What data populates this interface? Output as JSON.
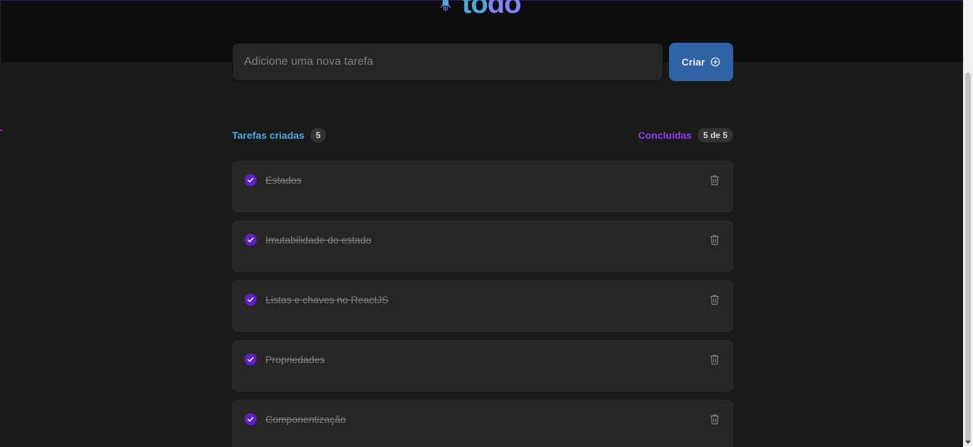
{
  "logo": {
    "part1": "to",
    "part2": "do",
    "icon": "rocket-icon"
  },
  "new_task": {
    "placeholder": "Adicione uma nova tarefa",
    "value": "",
    "create_label": "Criar",
    "create_icon": "plus-circle-icon"
  },
  "counters": {
    "created_label": "Tarefas criadas",
    "created_count": "5",
    "done_label": "Concluídas",
    "done_count": "5 de 5"
  },
  "tasks": [
    {
      "text": "Estados",
      "done": true
    },
    {
      "text": "Imutabilidade do estado",
      "done": true
    },
    {
      "text": "Listas e chaves no ReactJS",
      "done": true
    },
    {
      "text": "Propriedades",
      "done": true
    },
    {
      "text": "Componentização",
      "done": true
    }
  ],
  "colors": {
    "accent_blue": "#4ea8de",
    "accent_purple": "#8a3ff0",
    "button_blue": "#2e63a6",
    "check_purple": "#5e60ce"
  }
}
